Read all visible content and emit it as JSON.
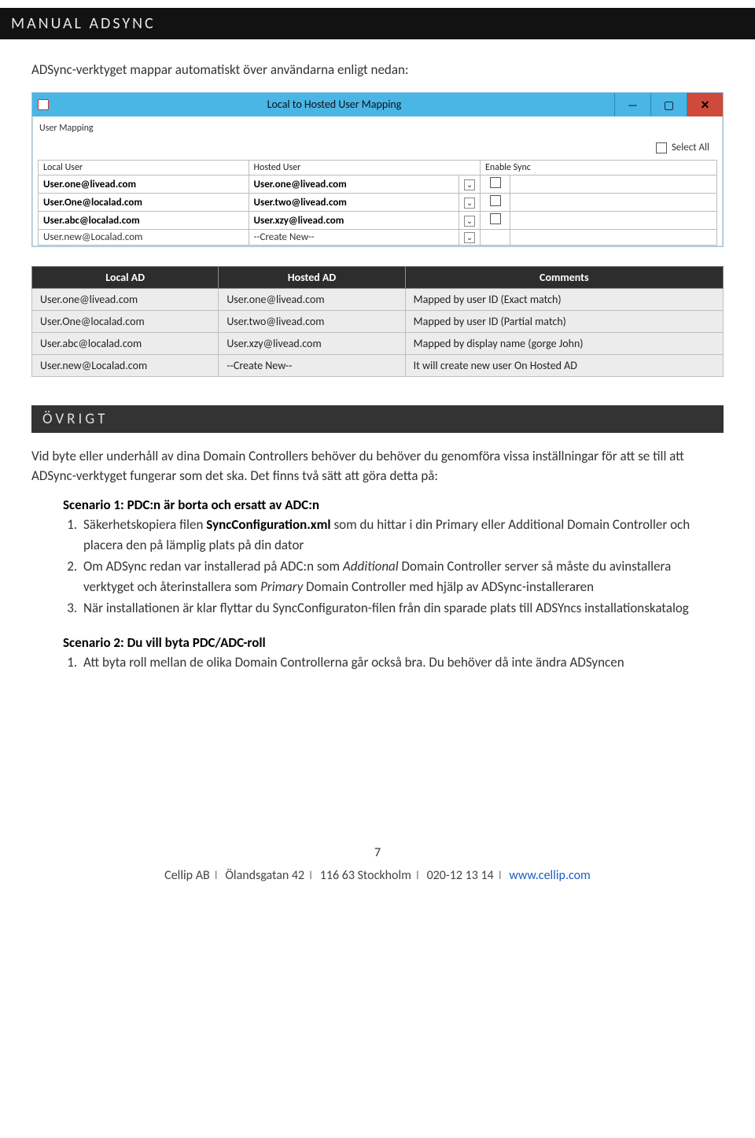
{
  "header": {
    "title": "MANUAL ADSYNC"
  },
  "intro": "ADSync-verktyget mappar automatiskt över användarna enligt nedan:",
  "app": {
    "title": "Local to Hosted User Mapping",
    "tab": "User Mapping",
    "select_all": "Select All",
    "columns": {
      "local": "Local User",
      "hosted": "Hosted User",
      "enable": "Enable Sync"
    },
    "rows": [
      {
        "local": "User.one@livead.com",
        "hosted": "User.one@livead.com"
      },
      {
        "local": "User.One@localad.com",
        "hosted": "User.two@livead.com"
      },
      {
        "local": "User.abc@localad.com",
        "hosted": "User.xzy@livead.com"
      },
      {
        "local": "User.new@Localad.com",
        "hosted": "--Create New--"
      }
    ]
  },
  "exp": {
    "headers": {
      "local": "Local AD",
      "hosted": "Hosted AD",
      "comments": "Comments"
    },
    "rows": [
      {
        "l": "User.one@livead.com",
        "h": "User.one@livead.com",
        "c": "Mapped by user ID (Exact match)"
      },
      {
        "l": "User.One@localad.com",
        "h": "User.two@livead.com",
        "c": "Mapped by user ID (Partial match)"
      },
      {
        "l": "User.abc@localad.com",
        "h": "User.xzy@livead.com",
        "c": "Mapped by display name (gorge John)"
      },
      {
        "l": "User.new@Localad.com",
        "h": "--Create New--",
        "c": "It will create new user On Hosted AD"
      }
    ]
  },
  "section": {
    "title": "ÖVRIGT"
  },
  "para1": "Vid byte eller underhåll av dina Domain Controllers behöver du behöver du genomföra vissa inställningar för att se till att ADSync-verktyget fungerar som det ska. Det finns två sätt att göra detta på:",
  "scenario1": {
    "title": "Scenario 1: PDC:n är borta och ersatt av ADC:n",
    "s1a": "Säkerhetskopiera filen ",
    "s1b": "SyncConfiguration.xml",
    "s1c": " som du hittar i din Primary eller Additional Domain Controller och placera den på lämplig plats på din dator",
    "s2a": "Om ADSync redan var installerad på ADC:n som ",
    "s2b": "Additional",
    "s2c": " Domain Controller server så måste du avinstallera verktyget och återinstallera som ",
    "s2d": "Primary",
    "s2e": " Domain Controller med hjälp av ADSync-installeraren",
    "s3": "När installationen är klar flyttar du SyncConfiguraton-filen från din sparade plats till ADSYncs installationskatalog"
  },
  "scenario2": {
    "title": "Scenario 2: Du vill byta PDC/ADC-roll",
    "s1": "Att byta roll mellan de olika Domain Controllerna går också bra. Du behöver då inte ändra ADSyncen"
  },
  "pagenum": "7",
  "footer": {
    "company": "Cellip AB",
    "addr1": "Ölandsgatan 42",
    "addr2": "116 63 Stockholm",
    "phone": "020-12 13 14",
    "url": "www.cellip.com"
  }
}
